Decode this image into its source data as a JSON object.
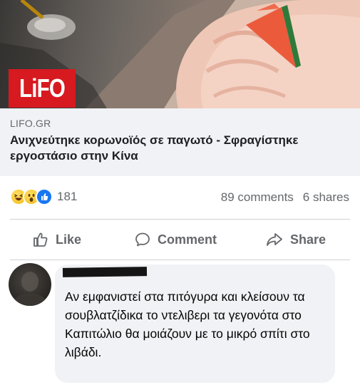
{
  "post": {
    "logo_text": "LiFO",
    "domain": "LIFO.GR",
    "headline": "Ανιχνεύτηκε κορωνοϊός σε παγωτό - Σφραγίστηκε εργοστάσιο στην Κίνα"
  },
  "stats": {
    "reaction_icons": [
      "haha-emoji",
      "wow-emoji",
      "like-icon"
    ],
    "reaction_count": "181",
    "comments": "89 comments",
    "shares": "6 shares"
  },
  "actions": {
    "like_label": "Like",
    "comment_label": "Comment",
    "share_label": "Share"
  },
  "comment": {
    "text": "Αν εμφανιστεί στα πιτόγυρα και κλείσουν τα σουβλατζίδικα το ντελιβερι τα γεγονότα στο Καπιτώλιο θα μοιάζουν με το μικρό σπίτι στο λιβάδι."
  },
  "colors": {
    "brand_red": "#d71920",
    "muted_text": "#65676b",
    "like_blue": "#1877f2",
    "bubble_bg": "#f0f2f5"
  }
}
